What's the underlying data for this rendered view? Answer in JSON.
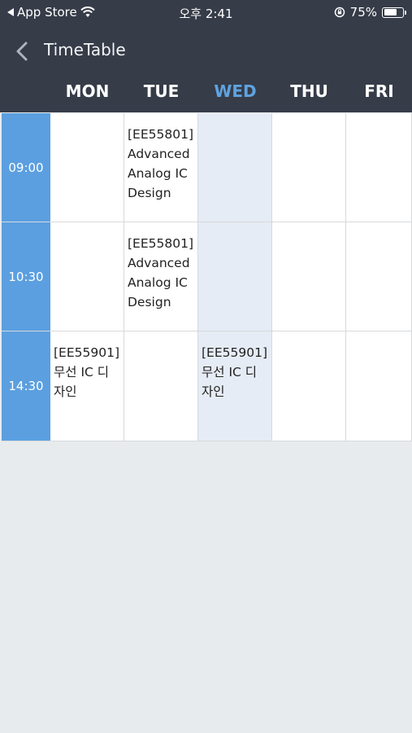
{
  "status_bar": {
    "back_app": "App Store",
    "time": "오후 2:41",
    "battery": "75%",
    "battery_level": 0.75
  },
  "nav": {
    "title": "TimeTable",
    "back_icon": "chevron-left-icon"
  },
  "days": [
    "MON",
    "TUE",
    "WED",
    "THU",
    "FRI"
  ],
  "active_day": "WED",
  "colors": {
    "header_bg": "#363c48",
    "active_day": "#5fa3e0",
    "time_column": "#5b9fe0",
    "current_day_column": "#e6ecf5",
    "page_bg": "#e8ebee"
  },
  "rows": [
    {
      "time": "09:00",
      "cells": [
        "",
        "[EE55801] Advanced Analog IC Design",
        "",
        "",
        ""
      ]
    },
    {
      "time": "10:30",
      "cells": [
        "",
        "[EE55801] Advanced Analog IC Design",
        "",
        "",
        ""
      ]
    },
    {
      "time": "14:30",
      "cells": [
        "[EE55901] 무선 IC 디자인",
        "",
        "[EE55901] 무선 IC 디자인",
        "",
        ""
      ]
    }
  ]
}
